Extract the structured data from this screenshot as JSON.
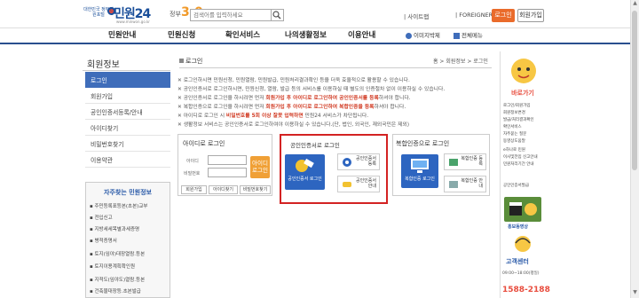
{
  "header": {
    "logo_gov": "대한민국 정부민원포털",
    "logo_main": "민원24",
    "logo_url": "www.minwon.go.kr",
    "gov30_label": "정부",
    "gov30_num": "3.0",
    "search_placeholder": "검색어를 입력하세요",
    "sitemap": "사이트맵",
    "foreigner": "FOREIGNER",
    "login": "로그인",
    "join": "회원가입"
  },
  "nav": {
    "items": [
      "민원안내",
      "민원신청",
      "확인서비스",
      "나의생활정보",
      "이용안내"
    ],
    "my_image": "이미지박제",
    "all_menu": "전체메뉴"
  },
  "sidebar": {
    "title": "회원정보",
    "items": [
      "로그인",
      "회원가입",
      "공인인증서등록/안내",
      "아이디찾기",
      "비밀번호찾기",
      "이용약관"
    ],
    "panel_title": "자주찾는 민원정보",
    "links": [
      "주민등록표등본(초본)교부",
      "전입신고",
      "지방세세목별과세증명",
      "병적증명서",
      "토지(임야)대장열람.등본",
      "토지이용계획확인원",
      "지적도(임야도)열람.등본",
      "건축물대장등.초본발급"
    ]
  },
  "content": {
    "crumb_title": "로그인",
    "crumb_path": "홈 > 회원정보 > 로그인",
    "notices": [
      {
        "text": "로그인하시면 민원신청, 민원열람, 민원발급, 민원처리결과확인 등을 더욱 효율적으로 활용할 수 있습니다.",
        "highlight": ""
      },
      {
        "text": "공인인증서로 로그인하시면, 민원신청, 열람, 발급 등의 서비스를 이용하실 때 별도의 인증절차 없이 이용하실 수 있습니다.",
        "highlight": ""
      },
      {
        "text": "공인인증서로 로그인을 하시려면 먼저 ",
        "highlight": "회원가입 후 아이디로 로그인하여 공인인증서를 등록"
      },
      {
        "text": "복합인증으로 로그인을 하시려면 먼저 ",
        "highlight": "회원가입 후 아이디로 로그인하여 복합인증을 등록"
      },
      {
        "text": "아이디로 로그인 시 ",
        "highlight": "비밀번호를 5회 이상 잘못 입력하면"
      },
      {
        "text": "생활정보 서비스는 공인인증서로 로그인하여야 이용하실 수 있습니다.(단, 법인, 외국인, 재외국민은 제외)",
        "highlight": ""
      }
    ],
    "notice_tails": [
      "",
      "",
      "하셔야 합니다.",
      "하셔야 합니다.",
      " 민원24 서비스가 차단됩니다.",
      ""
    ]
  },
  "login_id": {
    "title": "아이디로 로그인",
    "id_label": "아이디",
    "pw_label": "비밀번호",
    "button": "아이디 로그인",
    "join": "회원가입",
    "find_id": "아이디찾기",
    "find_pw": "비밀번호찾기"
  },
  "login_cert": {
    "title": "공인인증서로 로그인",
    "button": "공인인증서 로그인",
    "register": "공인인증서 등록",
    "guide": "공인인증서 안내"
  },
  "login_mobile": {
    "title": "복합인증으로 로그인",
    "button": "복합인증 로그인",
    "register": "복합인증 등록",
    "guide": "복합인증 안내"
  },
  "right_panel": {
    "quick_title": "바로가기",
    "links": [
      "로그인/회원가입",
      "회원정보변경",
      "발급/처리결과확인",
      "확인서비스",
      "자주묻는 질문",
      "동영상도움말"
    ],
    "links2": [
      "e하나로 민원",
      "이사및전입 신고안내",
      "민원처리기간 안내"
    ],
    "link3": "공인인증서발급",
    "promo_label": "홍보동영상",
    "call_title": "고객센터",
    "call_hours": "09:00~18:00(평일)",
    "call_number": "1588-2188"
  },
  "colors": {
    "accent_blue": "#2d65c0",
    "login_orange": "#ea6b2b",
    "highlight_red": "#d13a22",
    "cert_border": "#d32222"
  }
}
